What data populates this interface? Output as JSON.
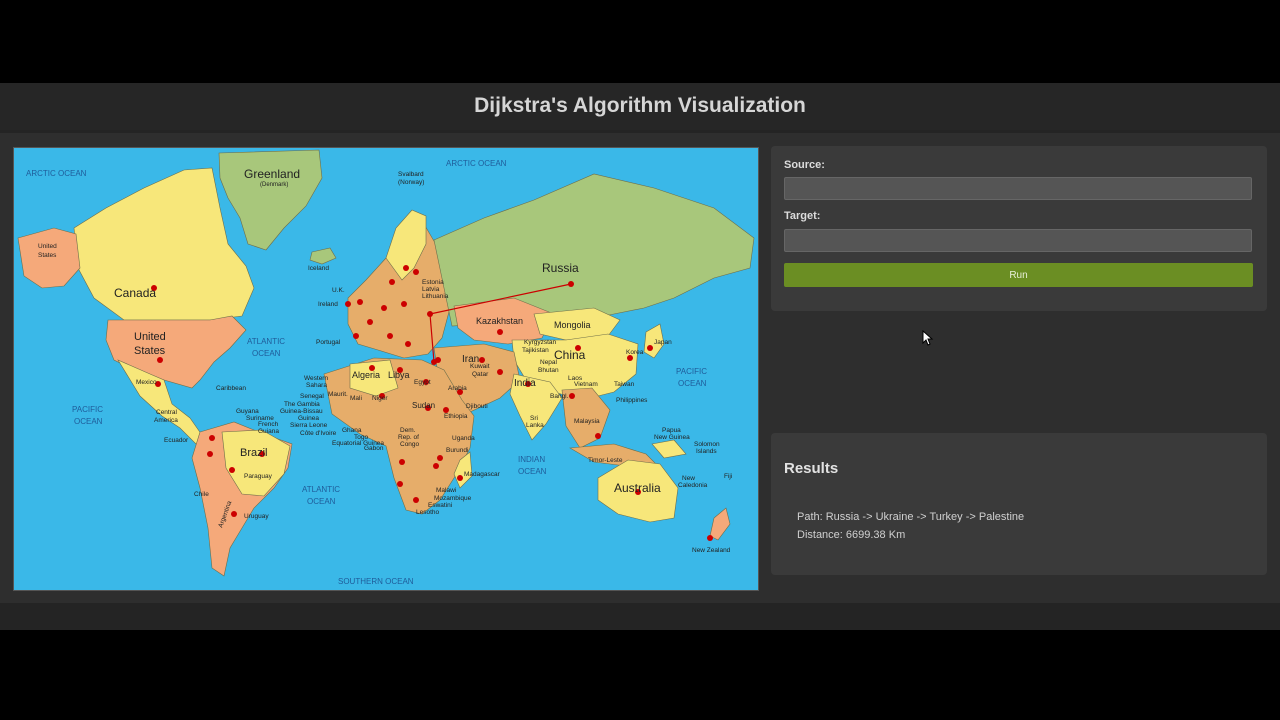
{
  "header": {
    "title": "Dijkstra's Algorithm Visualization"
  },
  "form": {
    "source_label": "Source:",
    "source_value": "",
    "target_label": "Target:",
    "target_value": "",
    "run_label": "Run"
  },
  "results": {
    "title": "Results",
    "path_text": "Path: Russia -> Ukraine -> Turkey -> Palestine",
    "distance_text": "Distance: 6699.38 Km"
  },
  "map": {
    "ocean_color": "#3ab8e8",
    "node_color": "#cc0000",
    "oceans": {
      "arctic_w": "ARCTIC OCEAN",
      "arctic_e": "ARCTIC OCEAN",
      "atlantic_n": "ATLANTIC",
      "atlantic_n2": "OCEAN",
      "atlantic_s": "ATLANTIC",
      "atlantic_s2": "OCEAN",
      "pacific_w": "PACIFIC",
      "pacific_w2": "OCEAN",
      "pacific_e": "PACIFIC",
      "pacific_e2": "OCEAN",
      "indian": "INDIAN",
      "indian2": "OCEAN",
      "southern": "SOUTHERN OCEAN"
    },
    "countries_large": {
      "greenland": "Greenland",
      "greenland_sub": "(Denmark)",
      "canada": "Canada",
      "united_states": "United",
      "united_states2": "States",
      "russia": "Russia",
      "china": "China",
      "brazil": "Brazil",
      "australia": "Australia",
      "kazakhstan": "Kazakhstan",
      "mongolia": "Mongolia",
      "india": "India",
      "iran": "Iran",
      "algeria": "Algeria",
      "libya": "Libya",
      "sudan": "Sudan"
    },
    "countries_small": {
      "alaska": "United",
      "alaska2": "States",
      "iceland": "Iceland",
      "mexico": "Mexico",
      "caribbean": "Caribbean",
      "central_america": "Central",
      "central_america2": "America",
      "ecuador": "Ecuador",
      "chile": "Chile",
      "argentina": "Argentina",
      "uruguay": "Uruguay",
      "paraguay": "Paraguay",
      "japan": "Japan",
      "philippines": "Philippines",
      "new_zealand": "New Zealand",
      "madagascar": "Madagascar",
      "egypt": "Egypt",
      "svalbard": "Svalbard",
      "svalbard2": "(Norway)",
      "portugal": "Portugal",
      "ireland": "Ireland",
      "uk": "U.K.",
      "taiwan": "Taiwan",
      "papua": "Papua",
      "papua2": "New Guinea",
      "solomon": "Solomon",
      "solomon2": "Islands",
      "fiji": "Fiji",
      "new_caledonia": "New",
      "new_caledonia2": "Caledonia",
      "sri_lanka": "Sri",
      "sri_lanka2": "Lanka",
      "timor": "Timor-Leste",
      "lesotho": "Lesotho",
      "mozambique": "Mozambique",
      "malawi": "Malawi",
      "eswatini": "Eswatini",
      "uganda": "Uganda",
      "burundi": "Burundi",
      "djibouti": "Djibouti",
      "ethiopia": "Ethiopia",
      "gabon": "Gabon",
      "dem_rep": "Dem.",
      "dem_rep2": "Rep. of",
      "dem_rep3": "Congo",
      "kyrgyzstan": "Kyrgyzstan",
      "tajikistan": "Tajikistan",
      "nepal": "Nepal",
      "bhutan": "Bhutan",
      "laos": "Laos",
      "vietnam": "Vietnam",
      "malaysia": "Malaysia",
      "korea": "Korea",
      "estonia": "Estonia",
      "latvia": "Latvia",
      "lithuania": "Lithuania",
      "guyana": "Guyana",
      "suriname": "Suriname",
      "french_guiana": "French",
      "french_guiana2": "Guiana",
      "western_sahara": "Western",
      "western_sahara2": "Sahara",
      "senegal": "Senegal",
      "gambia": "The Gambia",
      "guinea_bissau": "Guinea-Bissau",
      "guinea": "Guinea",
      "sierra_leone": "Sierra Leone",
      "cote_divoire": "Côte d'Ivoire",
      "ghana": "Ghana",
      "togo": "Togo",
      "equatorial_guinea": "Equatorial Guinea",
      "mauritania": "Maurit.",
      "mali": "Mali",
      "niger": "Niger",
      "arabia": "Arabia",
      "kuwait": "Kuwait",
      "qatar": "Qatar",
      "bangladesh": "Bangl."
    }
  }
}
